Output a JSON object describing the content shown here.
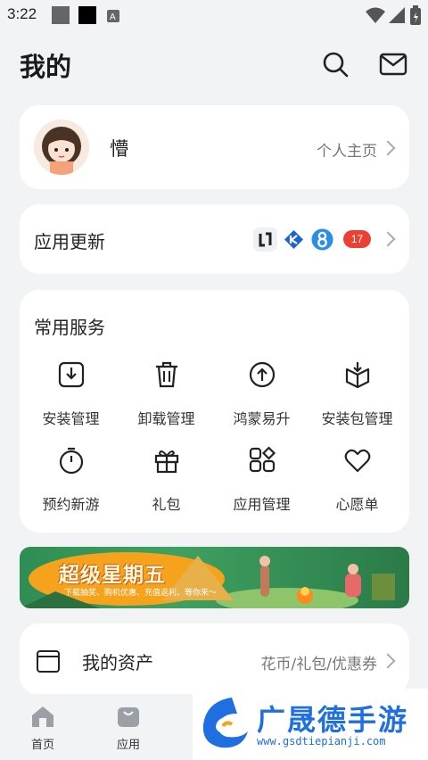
{
  "status_bar": {
    "time": "3:22",
    "icons": [
      "notification-square-icon",
      "black-square-icon",
      "a-icon",
      "wifi-icon",
      "signal-icon",
      "battery-icon"
    ]
  },
  "header": {
    "title": "我的",
    "icons": [
      "search-icon",
      "mail-icon"
    ]
  },
  "profile": {
    "username": "懵",
    "link_label": "个人主页"
  },
  "app_updates": {
    "label": "应用更新",
    "update_count": "17",
    "app_icons": [
      "app-icon-dark-arrows",
      "app-icon-blue-k",
      "app-icon-blue-8"
    ]
  },
  "services": {
    "label": "常用服务",
    "items": [
      {
        "label": "安装管理",
        "icon": "install-icon"
      },
      {
        "label": "卸载管理",
        "icon": "trash-icon"
      },
      {
        "label": "鸿蒙易升",
        "icon": "upgrade-icon"
      },
      {
        "label": "安装包管理",
        "icon": "package-icon"
      },
      {
        "label": "预约新游",
        "icon": "stopwatch-icon"
      },
      {
        "label": "礼包",
        "icon": "gift-icon"
      },
      {
        "label": "应用管理",
        "icon": "app-grid-icon"
      },
      {
        "label": "心愿单",
        "icon": "heart-icon"
      }
    ]
  },
  "banner": {
    "title": "超级星期五",
    "subtitle": "下载抽奖、购机优惠、充值返利，等你来～"
  },
  "assets": {
    "label": "我的资产",
    "link_label": "花币/礼包/优惠券"
  },
  "tabbar": {
    "items": [
      {
        "label": "首页",
        "icon": "home-icon"
      },
      {
        "label": "应用",
        "icon": "bag-icon"
      }
    ]
  },
  "watermark": {
    "name": "广晟德手游",
    "url": "www.gsdtiepianji.com"
  },
  "colors": {
    "background": "#f1f3f5",
    "card": "#ffffff",
    "badge": "#e94235",
    "watermark_blue": "#1f6fe0"
  }
}
